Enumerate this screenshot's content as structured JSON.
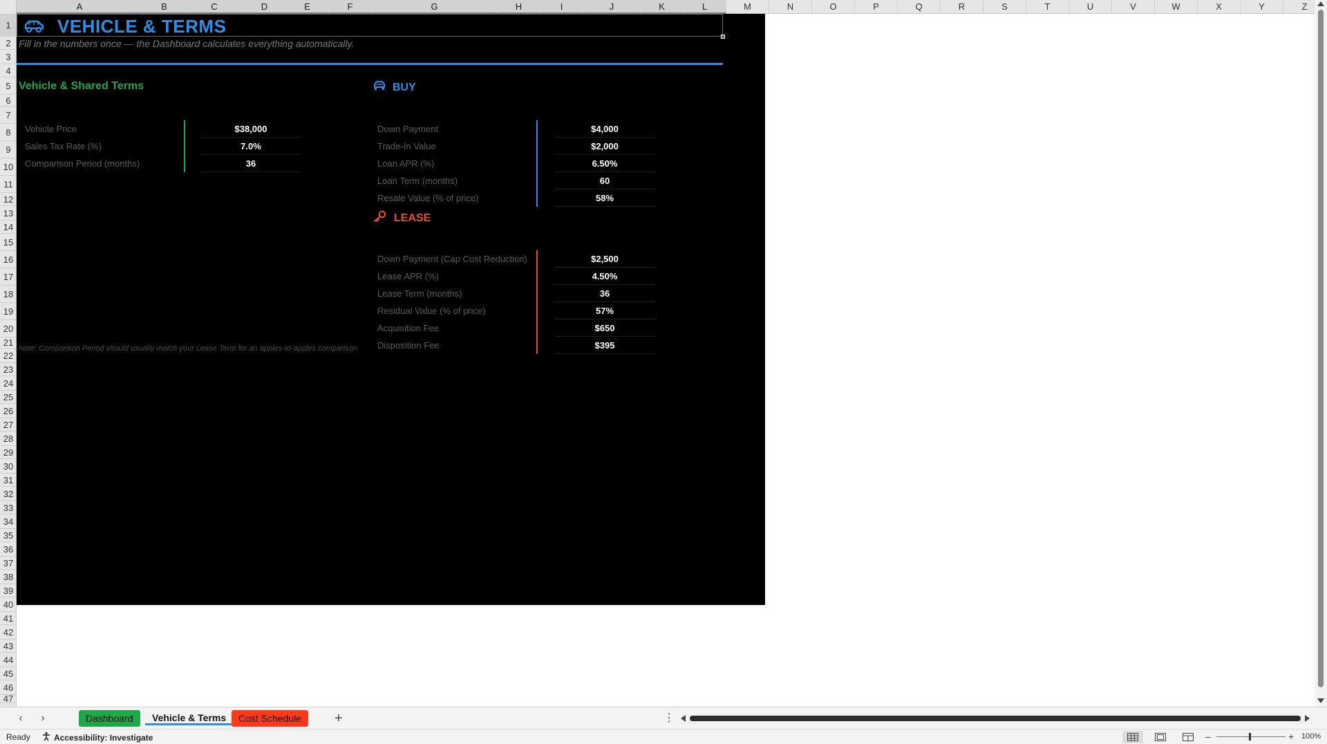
{
  "columns": [
    "A",
    "B",
    "C",
    "D",
    "E",
    "F",
    "G",
    "H",
    "I",
    "J",
    "K",
    "L",
    "M",
    "N",
    "O",
    "P",
    "Q",
    "R",
    "S",
    "T",
    "U",
    "V",
    "W",
    "X",
    "Y",
    "Z"
  ],
  "rows": [
    "1",
    "2",
    "3",
    "4",
    "5",
    "6",
    "7",
    "8",
    "9",
    "10",
    "11",
    "12",
    "13",
    "14",
    "15",
    "16",
    "17",
    "18",
    "19",
    "20",
    "21",
    "22",
    "23",
    "24",
    "25",
    "26",
    "27",
    "28",
    "29",
    "30",
    "31",
    "32",
    "33",
    "34",
    "35",
    "36",
    "37",
    "38",
    "39",
    "40",
    "41",
    "42",
    "43",
    "44",
    "45",
    "46",
    "47"
  ],
  "header": {
    "title": "VEHICLE & TERMS",
    "subtitle": "Fill in the numbers once — the Dashboard calculates everything automatically.",
    "icon": "car-icon"
  },
  "shared": {
    "title": "Vehicle & Shared Terms",
    "rows": [
      {
        "label": "Vehicle Price",
        "value": "$38,000"
      },
      {
        "label": "Sales Tax Rate (%)",
        "value": "7.0%"
      },
      {
        "label": "Comparison Period (months)",
        "value": "36"
      }
    ]
  },
  "buy": {
    "title": "BUY",
    "icon": "car-icon",
    "rows": [
      {
        "label": "Down Payment",
        "value": "$4,000"
      },
      {
        "label": "Trade-In Value",
        "value": "$2,000"
      },
      {
        "label": "Loan APR (%)",
        "value": "6.50%"
      },
      {
        "label": "Loan Term (months)",
        "value": "60"
      },
      {
        "label": "Resale Value (% of price)",
        "value": "58%"
      }
    ]
  },
  "lease": {
    "title": "LEASE",
    "icon": "key-icon",
    "rows": [
      {
        "label": "Down Payment (Cap Cost Reduction)",
        "value": "$2,500"
      },
      {
        "label": "Lease APR (%)",
        "value": "4.50%"
      },
      {
        "label": "Lease Term (months)",
        "value": "36"
      },
      {
        "label": "Residual Value (% of price)",
        "value": "57%"
      },
      {
        "label": "Acquisition Fee",
        "value": "$650"
      },
      {
        "label": "Disposition Fee",
        "value": "$395"
      }
    ]
  },
  "note": "Note: Comparison Period should usually match your Lease Term for an apples-to-apples comparison",
  "tabs": {
    "dashboard": "Dashboard",
    "vehicle": "Vehicle & Terms",
    "cost": "Cost Schedule",
    "add": "+"
  },
  "status": {
    "ready": "Ready",
    "accessibility": "Accessibility: Investigate",
    "zoom": "100%"
  },
  "colors": {
    "blue": "#2f8fe8",
    "green": "#1fa84a",
    "orange": "#e8502a",
    "tab_cost": "#ff3a1a",
    "background": "#000000"
  }
}
